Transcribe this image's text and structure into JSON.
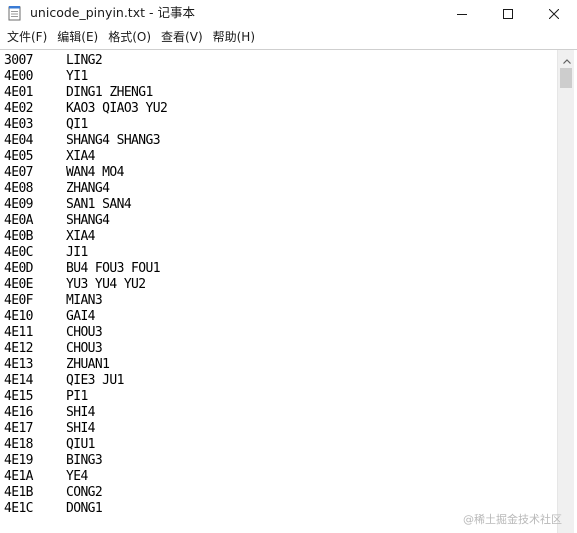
{
  "window": {
    "title": "unicode_pinyin.txt - 记事本",
    "app_icon": "notepad-icon",
    "controls": {
      "minimize_icon": "minimize-icon",
      "maximize_icon": "maximize-icon",
      "close_icon": "close-icon"
    }
  },
  "menu": [
    {
      "label": "文件(F)"
    },
    {
      "label": "编辑(E)"
    },
    {
      "label": "格式(O)"
    },
    {
      "label": "查看(V)"
    },
    {
      "label": "帮助(H)"
    }
  ],
  "content": {
    "lines": [
      {
        "code": "3007",
        "pinyin": "LING2"
      },
      {
        "code": "4E00",
        "pinyin": "YI1"
      },
      {
        "code": "4E01",
        "pinyin": "DING1 ZHENG1"
      },
      {
        "code": "4E02",
        "pinyin": "KAO3 QIAO3 YU2"
      },
      {
        "code": "4E03",
        "pinyin": "QI1"
      },
      {
        "code": "4E04",
        "pinyin": "SHANG4 SHANG3"
      },
      {
        "code": "4E05",
        "pinyin": "XIA4"
      },
      {
        "code": "4E07",
        "pinyin": "WAN4 MO4"
      },
      {
        "code": "4E08",
        "pinyin": "ZHANG4"
      },
      {
        "code": "4E09",
        "pinyin": "SAN1 SAN4"
      },
      {
        "code": "4E0A",
        "pinyin": "SHANG4"
      },
      {
        "code": "4E0B",
        "pinyin": "XIA4"
      },
      {
        "code": "4E0C",
        "pinyin": "JI1"
      },
      {
        "code": "4E0D",
        "pinyin": "BU4 FOU3 FOU1"
      },
      {
        "code": "4E0E",
        "pinyin": "YU3 YU4 YU2"
      },
      {
        "code": "4E0F",
        "pinyin": "MIAN3"
      },
      {
        "code": "4E10",
        "pinyin": "GAI4"
      },
      {
        "code": "4E11",
        "pinyin": "CHOU3"
      },
      {
        "code": "4E12",
        "pinyin": "CHOU3"
      },
      {
        "code": "4E13",
        "pinyin": "ZHUAN1"
      },
      {
        "code": "4E14",
        "pinyin": "QIE3 JU1"
      },
      {
        "code": "4E15",
        "pinyin": "PI1"
      },
      {
        "code": "4E16",
        "pinyin": "SHI4"
      },
      {
        "code": "4E17",
        "pinyin": "SHI4"
      },
      {
        "code": "4E18",
        "pinyin": "QIU1"
      },
      {
        "code": "4E19",
        "pinyin": "BING3"
      },
      {
        "code": "4E1A",
        "pinyin": "YE4"
      },
      {
        "code": "4E1B",
        "pinyin": "CONG2"
      },
      {
        "code": "4E1C",
        "pinyin": "DONG1"
      }
    ]
  },
  "scrollbar": {
    "up_icon": "scroll-up-arrow-icon",
    "position": 0
  },
  "watermark": "@稀土掘金技术社区"
}
